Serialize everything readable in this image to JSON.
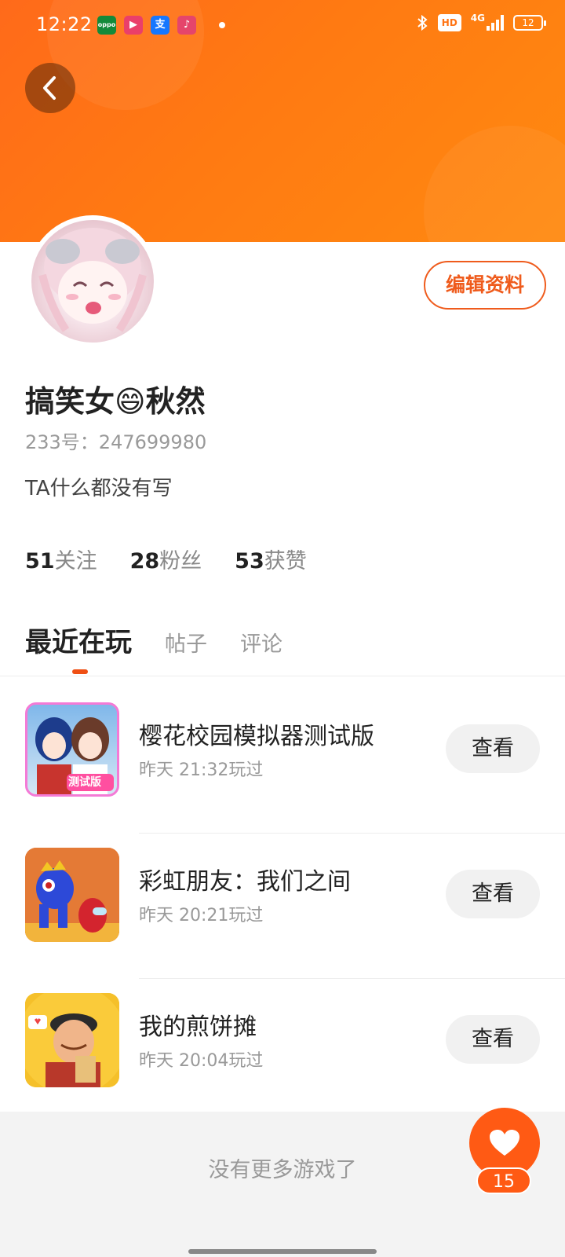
{
  "status_bar": {
    "time": "12:22",
    "network": "4G",
    "hd": "HD",
    "battery": "12",
    "apps": [
      {
        "name": "oppo-app-icon",
        "label": "oppo",
        "color": "#138a3a"
      },
      {
        "name": "video-app-icon",
        "label": "▶",
        "color": "#ea3f6a"
      },
      {
        "name": "alipay-app-icon",
        "label": "支",
        "color": "#1677ff"
      },
      {
        "name": "music-app-icon",
        "label": "♪",
        "color": "#e5456b"
      }
    ]
  },
  "header": {
    "back_icon": "back-arrow-icon"
  },
  "profile": {
    "username": "搞笑女😄秋然",
    "user_id": "233号：247699980",
    "bio": "TA什么都没有写",
    "edit_label": "编辑资料",
    "stats": [
      {
        "num": "51",
        "label": "关注"
      },
      {
        "num": "28",
        "label": "粉丝"
      },
      {
        "num": "53",
        "label": "获赞"
      }
    ]
  },
  "tabs": [
    {
      "label": "最近在玩",
      "active": true
    },
    {
      "label": "帖子",
      "active": false
    },
    {
      "label": "评论",
      "active": false
    }
  ],
  "games": [
    {
      "title": "樱花校园模拟器测试版",
      "time": "昨天 21:32玩过",
      "action": "查看",
      "icon_badge": "测试版"
    },
    {
      "title": "彩虹朋友：我们之间",
      "time": "昨天 20:21玩过",
      "action": "查看"
    },
    {
      "title": "我的煎饼摊",
      "time": "昨天 20:04玩过",
      "action": "查看"
    }
  ],
  "footer": {
    "text": "没有更多游戏了"
  },
  "like": {
    "count": "15"
  },
  "colors": {
    "accent": "#ef5b1c",
    "banner": "#ff7414"
  }
}
